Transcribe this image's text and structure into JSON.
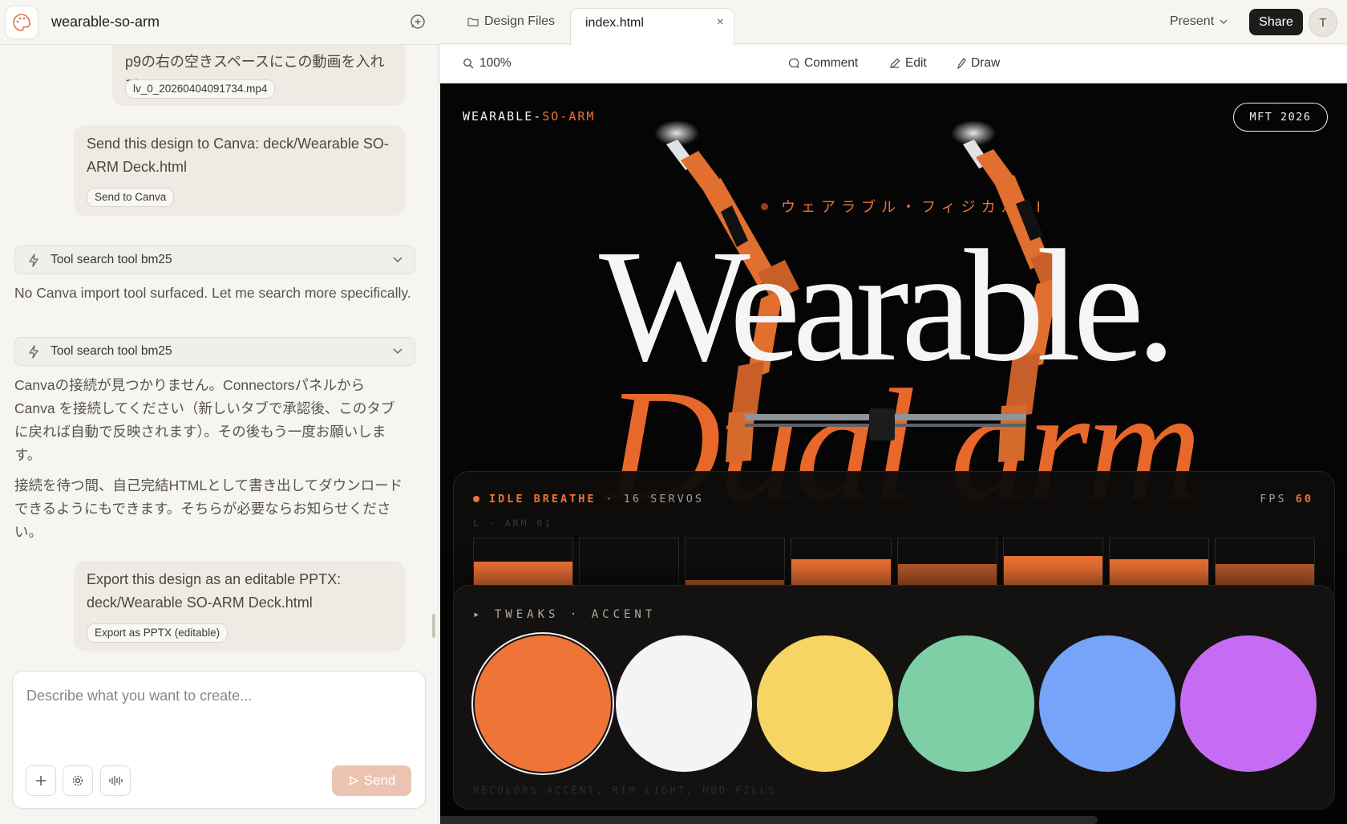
{
  "project": {
    "title": "wearable-so-arm"
  },
  "chat": {
    "items": [
      {
        "text": "p9の右の空きスペースにこの動画を入れて",
        "attachment": "lv_0_20260404091734.mp4"
      },
      {
        "text": "Send this design to Canva: deck/Wearable SO-ARM Deck.html",
        "chip": "Send to Canva"
      },
      {
        "tool": "Tool search tool bm25"
      },
      {
        "text": "No Canva import tool surfaced. Let me search more specifically."
      },
      {
        "tool": "Tool search tool bm25"
      },
      {
        "text": "Canvaの接続が見つかりません。Connectorsパネルから Canva を接続してください（新しいタブで承認後、このタブに戻れば自動で反映されます）。その後もう一度お願いします。"
      },
      {
        "text": "接続を待つ間、自己完結HTMLとして書き出してダウンロードできるようにもできます。そちらが必要ならお知らせください。"
      },
      {
        "text": "Export this design as an editable PPTX: deck/Wearable SO-ARM Deck.html",
        "chip": "Export as PPTX (editable)"
      }
    ]
  },
  "composer": {
    "placeholder": "Describe what you want to create...",
    "send_label": "Send"
  },
  "tabs": {
    "files_label": "Design Files",
    "active_label": "index.html"
  },
  "header": {
    "present_label": "Present",
    "share_label": "Share",
    "avatar_initial": "T"
  },
  "toolbar": {
    "zoom": "100%",
    "comment": "Comment",
    "edit": "Edit",
    "draw": "Draw"
  },
  "slide": {
    "brand_main": "WEARABLE-",
    "brand_accent": "SO-ARM",
    "badge": "MFT 2026",
    "kicker": "ウェアラブル・フィジカルAI",
    "headline": "Wearable.",
    "headline2": "Dual arm"
  },
  "hud": {
    "status": "IDLE BREATHE",
    "servos_label": "· 16 SERVOS",
    "fps_label": "FPS",
    "fps_value": "60",
    "sublabel": "L · ARM 01",
    "servos": [
      {
        "level": 0.55,
        "color": "#ee7234"
      },
      {
        "level": 0.0,
        "color": "#ee7234"
      },
      {
        "level": 0.18,
        "color": "#b95a2c"
      },
      {
        "level": 0.6,
        "color": "#ee7234"
      },
      {
        "level": 0.5,
        "color": "#b95a2c"
      },
      {
        "level": 0.65,
        "color": "#ee7234"
      },
      {
        "level": 0.6,
        "color": "#ee7234"
      },
      {
        "level": 0.5,
        "color": "#b95a2c"
      }
    ]
  },
  "tweaks": {
    "title": "▸ TWEAKS · ACCENT",
    "footnote": "RECOLORS ACCENT, RIM LIGHT, HUD FILLS",
    "swatches": [
      {
        "name": "orange",
        "color": "#ef7437",
        "selected": true
      },
      {
        "name": "white",
        "color": "#f4f4f6",
        "selected": false
      },
      {
        "name": "yellow",
        "color": "#f7d564",
        "selected": false
      },
      {
        "name": "green",
        "color": "#7ecfa6",
        "selected": false
      },
      {
        "name": "blue",
        "color": "#76a4f8",
        "selected": false
      },
      {
        "name": "purple",
        "color": "#c66cf4",
        "selected": false
      }
    ]
  },
  "colors": {
    "accent": "#ee7234",
    "send_bg": "#ecc3b1"
  }
}
